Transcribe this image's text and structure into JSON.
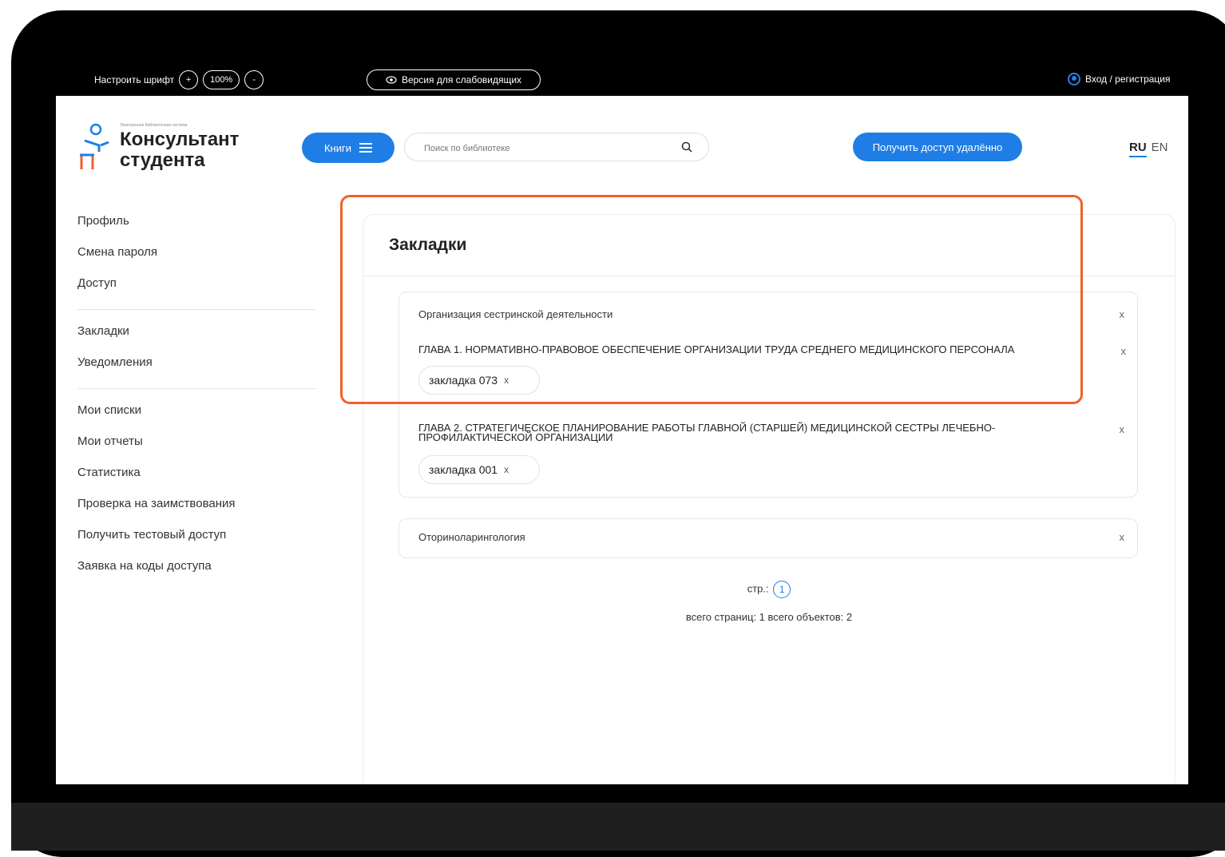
{
  "topbar": {
    "font_label": "Настроить шрифт",
    "increase": "+",
    "zoom": "100%",
    "decrease": "-",
    "vision_label": "Версия для слабовидящих",
    "login_label": "Вход / регистрация"
  },
  "header": {
    "logo_small": "Электронная библиотечная система",
    "logo_line1": "Консультант",
    "logo_line2": "студента",
    "books_label": "Книги",
    "search_placeholder": "Поиск по библиотеке",
    "remote_access_label": "Получить доступ удалённо",
    "lang_ru": "RU",
    "lang_en": "EN"
  },
  "sidebar": {
    "group1": [
      "Профиль",
      "Смена пароля",
      "Доступ"
    ],
    "group2": [
      "Закладки",
      "Уведомления"
    ],
    "group3": [
      "Мои списки",
      "Мои отчеты",
      "Статистика",
      "Проверка на заимствования",
      "Получить тестовый доступ",
      "Заявка на коды доступа"
    ]
  },
  "main": {
    "title": "Закладки",
    "books": [
      {
        "title": "Организация сестринской деятельности",
        "close": "x",
        "chapters": [
          {
            "title": "ГЛАВА 1. НОРМАТИВНО-ПРАВОВОЕ ОБЕСПЕЧЕНИЕ ОРГАНИЗАЦИИ ТРУДА СРЕДНЕГО МЕДИЦИНСКОГО ПЕРСОНАЛА",
            "close": "x",
            "bookmark": "закладка 073",
            "bookmark_close": "x"
          },
          {
            "title": "ГЛАВА 2. СТРАТЕГИЧЕСКОЕ ПЛАНИРОВАНИЕ РАБОТЫ ГЛАВНОЙ (СТАРШЕЙ) МЕДИЦИНСКОЙ СЕСТРЫ ЛЕЧЕБНО-ПРОФИЛАКТИЧЕСКОЙ ОРГАНИЗАЦИИ",
            "close": "x",
            "bookmark": "закладка 001",
            "bookmark_close": "x"
          }
        ]
      },
      {
        "title": "Оториноларингология",
        "close": "x"
      }
    ],
    "pager_label": "стр.:",
    "current_page": "1",
    "totals": "всего страниц: 1 всего объектов: 2"
  },
  "colors": {
    "accent": "#1e7ee6",
    "highlight": "#f0602b"
  }
}
